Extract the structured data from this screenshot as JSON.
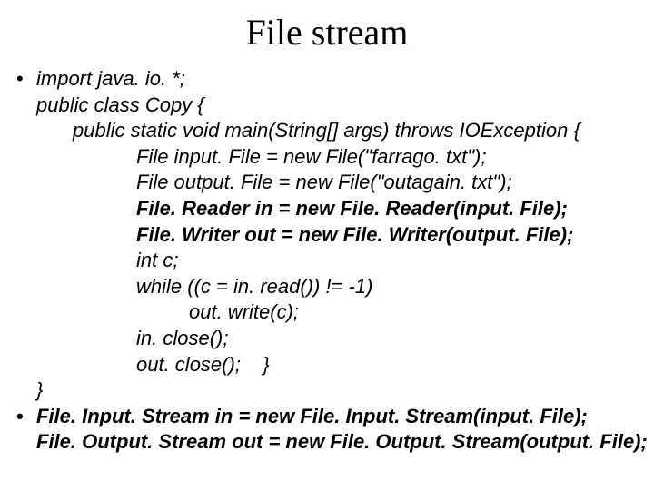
{
  "title": "File stream",
  "lines": [
    {
      "bullet": "•",
      "cls": "row",
      "text": "import java. io. *;",
      "bold": false
    },
    {
      "bullet": "",
      "cls": "row indent1",
      "text": "public class Copy {",
      "bold": false
    },
    {
      "bullet": "",
      "cls": "row indent2",
      "text": "public static void main(String[] args) throws IOException {",
      "bold": false
    },
    {
      "bullet": "",
      "cls": "row indent3",
      "text": "File input. File = new File(\"farrago. txt\");",
      "bold": false
    },
    {
      "bullet": "",
      "cls": "row indent3",
      "text": "File output. File = new File(\"outagain. txt\");",
      "bold": false
    },
    {
      "bullet": "",
      "cls": "row indent3",
      "text": "File. Reader in = new File. Reader(input. File);",
      "bold": true
    },
    {
      "bullet": "",
      "cls": "row indent3",
      "text": "File. Writer out = new File. Writer(output. File);",
      "bold": true
    },
    {
      "bullet": "",
      "cls": "row indent3",
      "text": "int c;",
      "bold": false
    },
    {
      "bullet": "",
      "cls": "row indent3",
      "text": "while ((c = in. read()) != -1)",
      "bold": false
    },
    {
      "bullet": "",
      "cls": "row indent4",
      "text": "out. write(c);",
      "bold": false
    },
    {
      "bullet": "",
      "cls": "row indent3",
      "text": "in. close();",
      "bold": false
    },
    {
      "bullet": "",
      "cls": "row indent3",
      "text": "out. close();    }",
      "bold": false
    },
    {
      "bullet": "",
      "cls": "row indent1",
      "text": "}",
      "bold": false
    },
    {
      "bullet": "•",
      "cls": "row",
      "text": "File. Input. Stream in = new File. Input. Stream(input. File);",
      "bold": true
    },
    {
      "bullet": "",
      "cls": "row indent1",
      "text": "File. Output. Stream out = new File. Output. Stream(output. File);",
      "bold": true
    }
  ]
}
